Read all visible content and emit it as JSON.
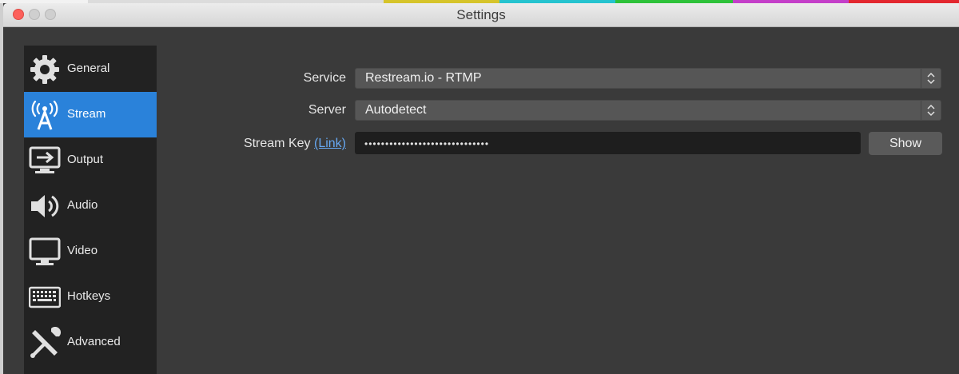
{
  "window": {
    "title": "Settings"
  },
  "colors": {
    "accent": "#2a82da",
    "strip": [
      "#f2f2f2",
      "#dcdcdc",
      "#d6c42a",
      "#25c3cf",
      "#2ec23a",
      "#c43fc9",
      "#e3272f"
    ]
  },
  "sidebar": {
    "items": [
      {
        "label": "General",
        "icon": "gear-icon",
        "active": false
      },
      {
        "label": "Stream",
        "icon": "broadcast-icon",
        "active": true
      },
      {
        "label": "Output",
        "icon": "output-icon",
        "active": false
      },
      {
        "label": "Audio",
        "icon": "speaker-icon",
        "active": false
      },
      {
        "label": "Video",
        "icon": "monitor-icon",
        "active": false
      },
      {
        "label": "Hotkeys",
        "icon": "keyboard-icon",
        "active": false
      },
      {
        "label": "Advanced",
        "icon": "tools-icon",
        "active": false
      }
    ]
  },
  "form": {
    "service_label": "Service",
    "service_value": "Restream.io - RTMP",
    "server_label": "Server",
    "server_value": "Autodetect",
    "stream_key_label": "Stream Key",
    "stream_key_link": "(Link)",
    "stream_key_value": "••••••••••••••••••••••••••••••",
    "show_button": "Show"
  }
}
